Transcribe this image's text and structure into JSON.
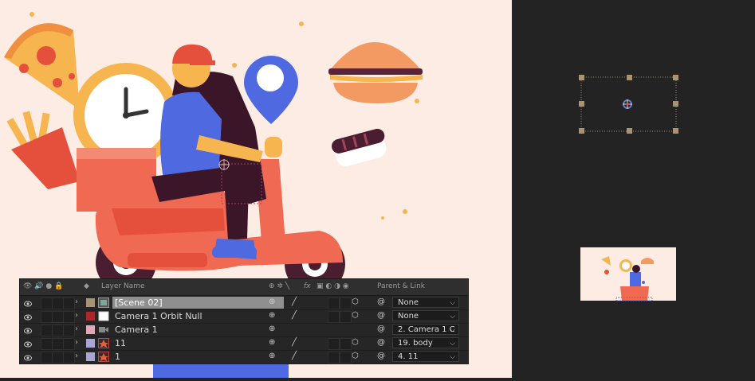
{
  "layer_panel": {
    "headers": {
      "layer_name": "Layer Name",
      "parent_link": "Parent & Link",
      "fx": "fx"
    },
    "layers": [
      {
        "name": "[Scene 02]",
        "parent": "None",
        "label_color": "#a89474",
        "type": "precomp",
        "selected": true
      },
      {
        "name": "Camera 1 Orbit Null",
        "parent": "None",
        "label_color": "#a8292c",
        "type": "null",
        "selected": false
      },
      {
        "name": "Camera 1",
        "parent": "2. Camera 1 C",
        "label_color": "#e2a8b6",
        "type": "camera",
        "selected": false
      },
      {
        "name": "11",
        "parent": "19. body",
        "label_color": "#a9a6d6",
        "type": "shape",
        "selected": false
      },
      {
        "name": "1",
        "parent": "4. 11",
        "label_color": "#a9a6d6",
        "type": "shape",
        "selected": false
      }
    ]
  },
  "colors": {
    "canvas_bg": "#fdece4",
    "panel_bg": "#232323",
    "selection": "#8f8f8f"
  }
}
